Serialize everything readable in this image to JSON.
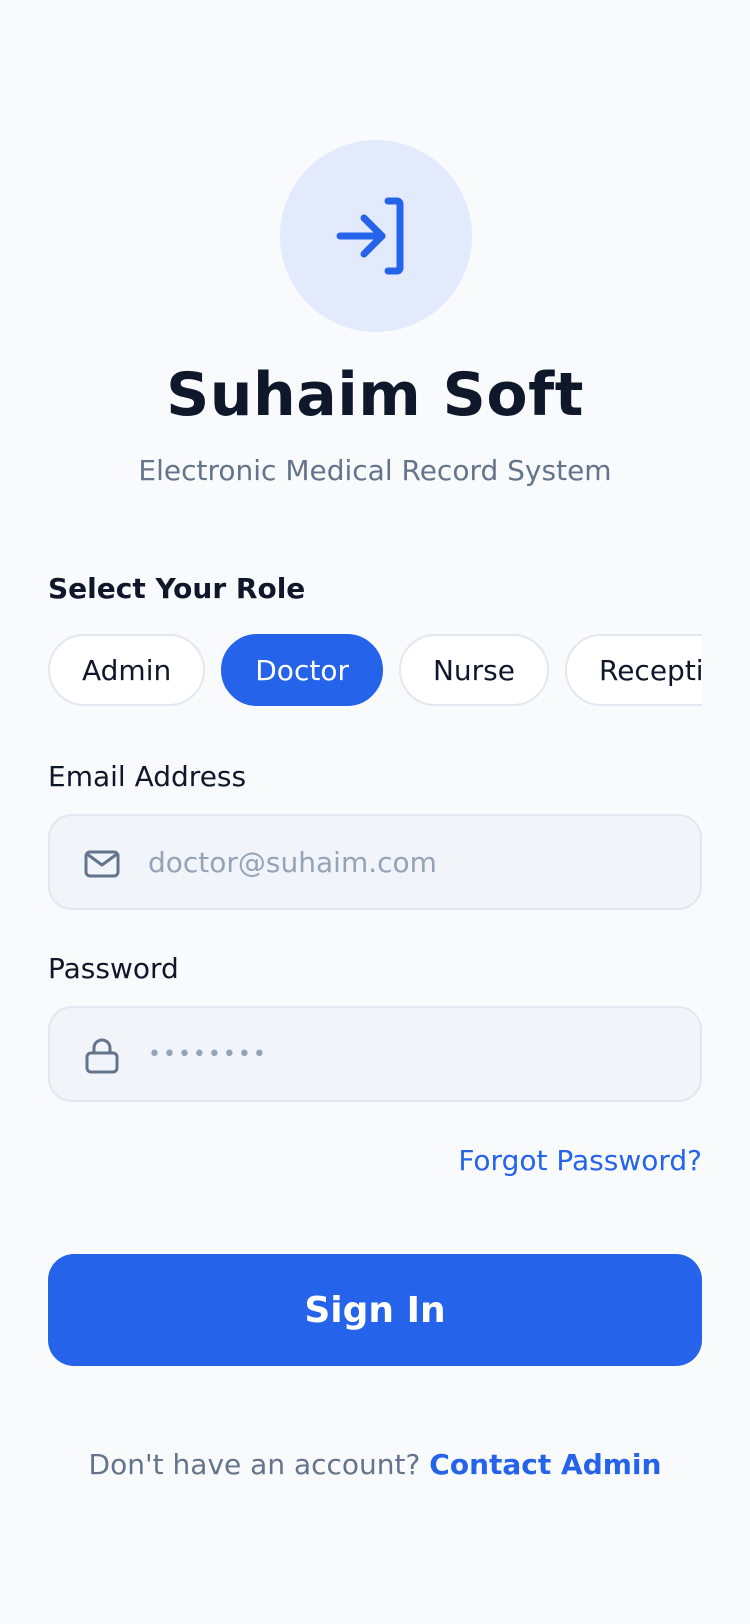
{
  "app": {
    "title": "Suhaim Soft",
    "subtitle": "Electronic Medical Record System",
    "logo_icon": "sign-in-icon"
  },
  "roles": {
    "label": "Select Your Role",
    "items": [
      {
        "label": "Admin",
        "selected": false
      },
      {
        "label": "Doctor",
        "selected": true
      },
      {
        "label": "Nurse",
        "selected": false
      },
      {
        "label": "Receptionist",
        "selected": false
      }
    ]
  },
  "email": {
    "label": "Email Address",
    "placeholder": "doctor@suhaim.com",
    "icon": "mail-icon"
  },
  "password": {
    "label": "Password",
    "placeholder": "••••••••",
    "icon": "lock-icon"
  },
  "actions": {
    "forgot_password": "Forgot Password?",
    "sign_in": "Sign In"
  },
  "footer": {
    "prompt": "Don't have an account?",
    "link": "Contact Admin"
  },
  "colors": {
    "accent": "#2563eb",
    "background": "#f8fafc",
    "logo_bg": "#e3eafb",
    "muted_text": "#64748b",
    "placeholder_text": "#94a3b8"
  }
}
